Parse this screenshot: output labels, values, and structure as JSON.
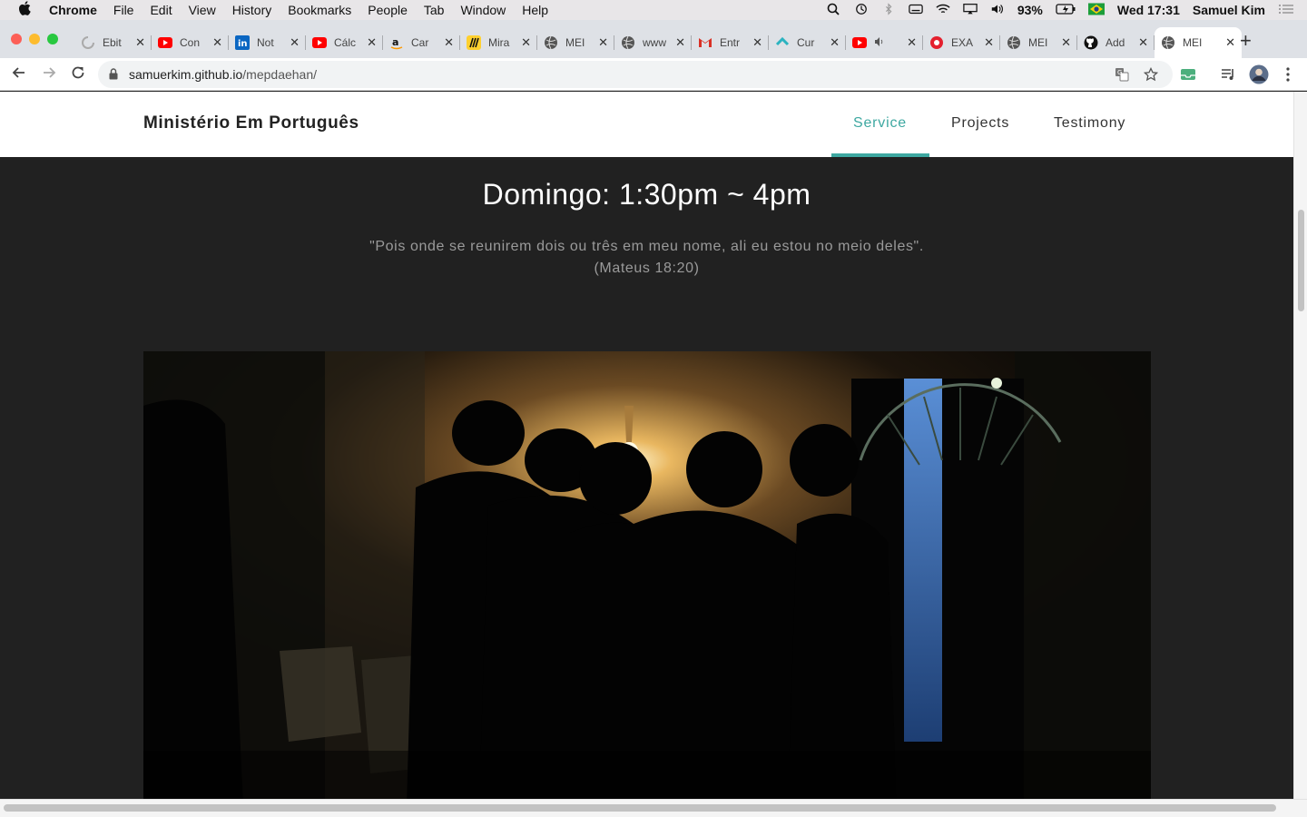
{
  "menubar": {
    "app": "Chrome",
    "items": [
      "File",
      "Edit",
      "View",
      "History",
      "Bookmarks",
      "People",
      "Tab",
      "Window",
      "Help"
    ],
    "battery": "93%",
    "clock": "Wed 17:31",
    "user": "Samuel Kim"
  },
  "tabs": [
    {
      "label": "Ebit",
      "icon": "loading-icon",
      "color": "#bdbdbd"
    },
    {
      "label": "Con",
      "icon": "youtube-icon",
      "color": "#ff0000"
    },
    {
      "label": "Not",
      "icon": "linkedin-icon",
      "color": "#0a66c2"
    },
    {
      "label": "Cálc",
      "icon": "youtube-icon",
      "color": "#ff0000"
    },
    {
      "label": "Car",
      "icon": "amazon-icon",
      "color": "#ffffff"
    },
    {
      "label": "Mira",
      "icon": "miro-icon",
      "color": "#ffd02f"
    },
    {
      "label": "MEI",
      "icon": "globe-icon",
      "color": "#555555"
    },
    {
      "label": "www",
      "icon": "globe-icon",
      "color": "#555555"
    },
    {
      "label": "Entr",
      "icon": "gmail-icon",
      "color": "#ffffff"
    },
    {
      "label": "Cur",
      "icon": "course-icon",
      "color": "#2bb3c0"
    },
    {
      "label": "",
      "icon": "youtube-icon",
      "color": "#ff0000"
    },
    {
      "label": "EXA",
      "icon": "app-icon",
      "color": "#e4202e"
    },
    {
      "label": "MEI",
      "icon": "globe-icon",
      "color": "#555555"
    },
    {
      "label": "Add",
      "icon": "github-icon",
      "color": "#000000"
    },
    {
      "label": "MEI",
      "icon": "globe-icon",
      "color": "#555555",
      "active": true
    }
  ],
  "address": {
    "host": "samuerkim.github.io",
    "path": "/mepdaehan/"
  },
  "site": {
    "brand": "Ministério Em Português",
    "nav": [
      "Service",
      "Projects",
      "Testimony"
    ],
    "active_nav": "Service",
    "accent": "#3ea8a1"
  },
  "hero": {
    "title": "Domingo: 1:30pm ~ 4pm",
    "quote_line1": "\"Pois onde se reunirem dois ou três em meu nome, ali eu estou no meio deles\".",
    "quote_line2": "(Mateus 18:20)"
  },
  "photo": {
    "subject": "group-silhouette-photo"
  }
}
